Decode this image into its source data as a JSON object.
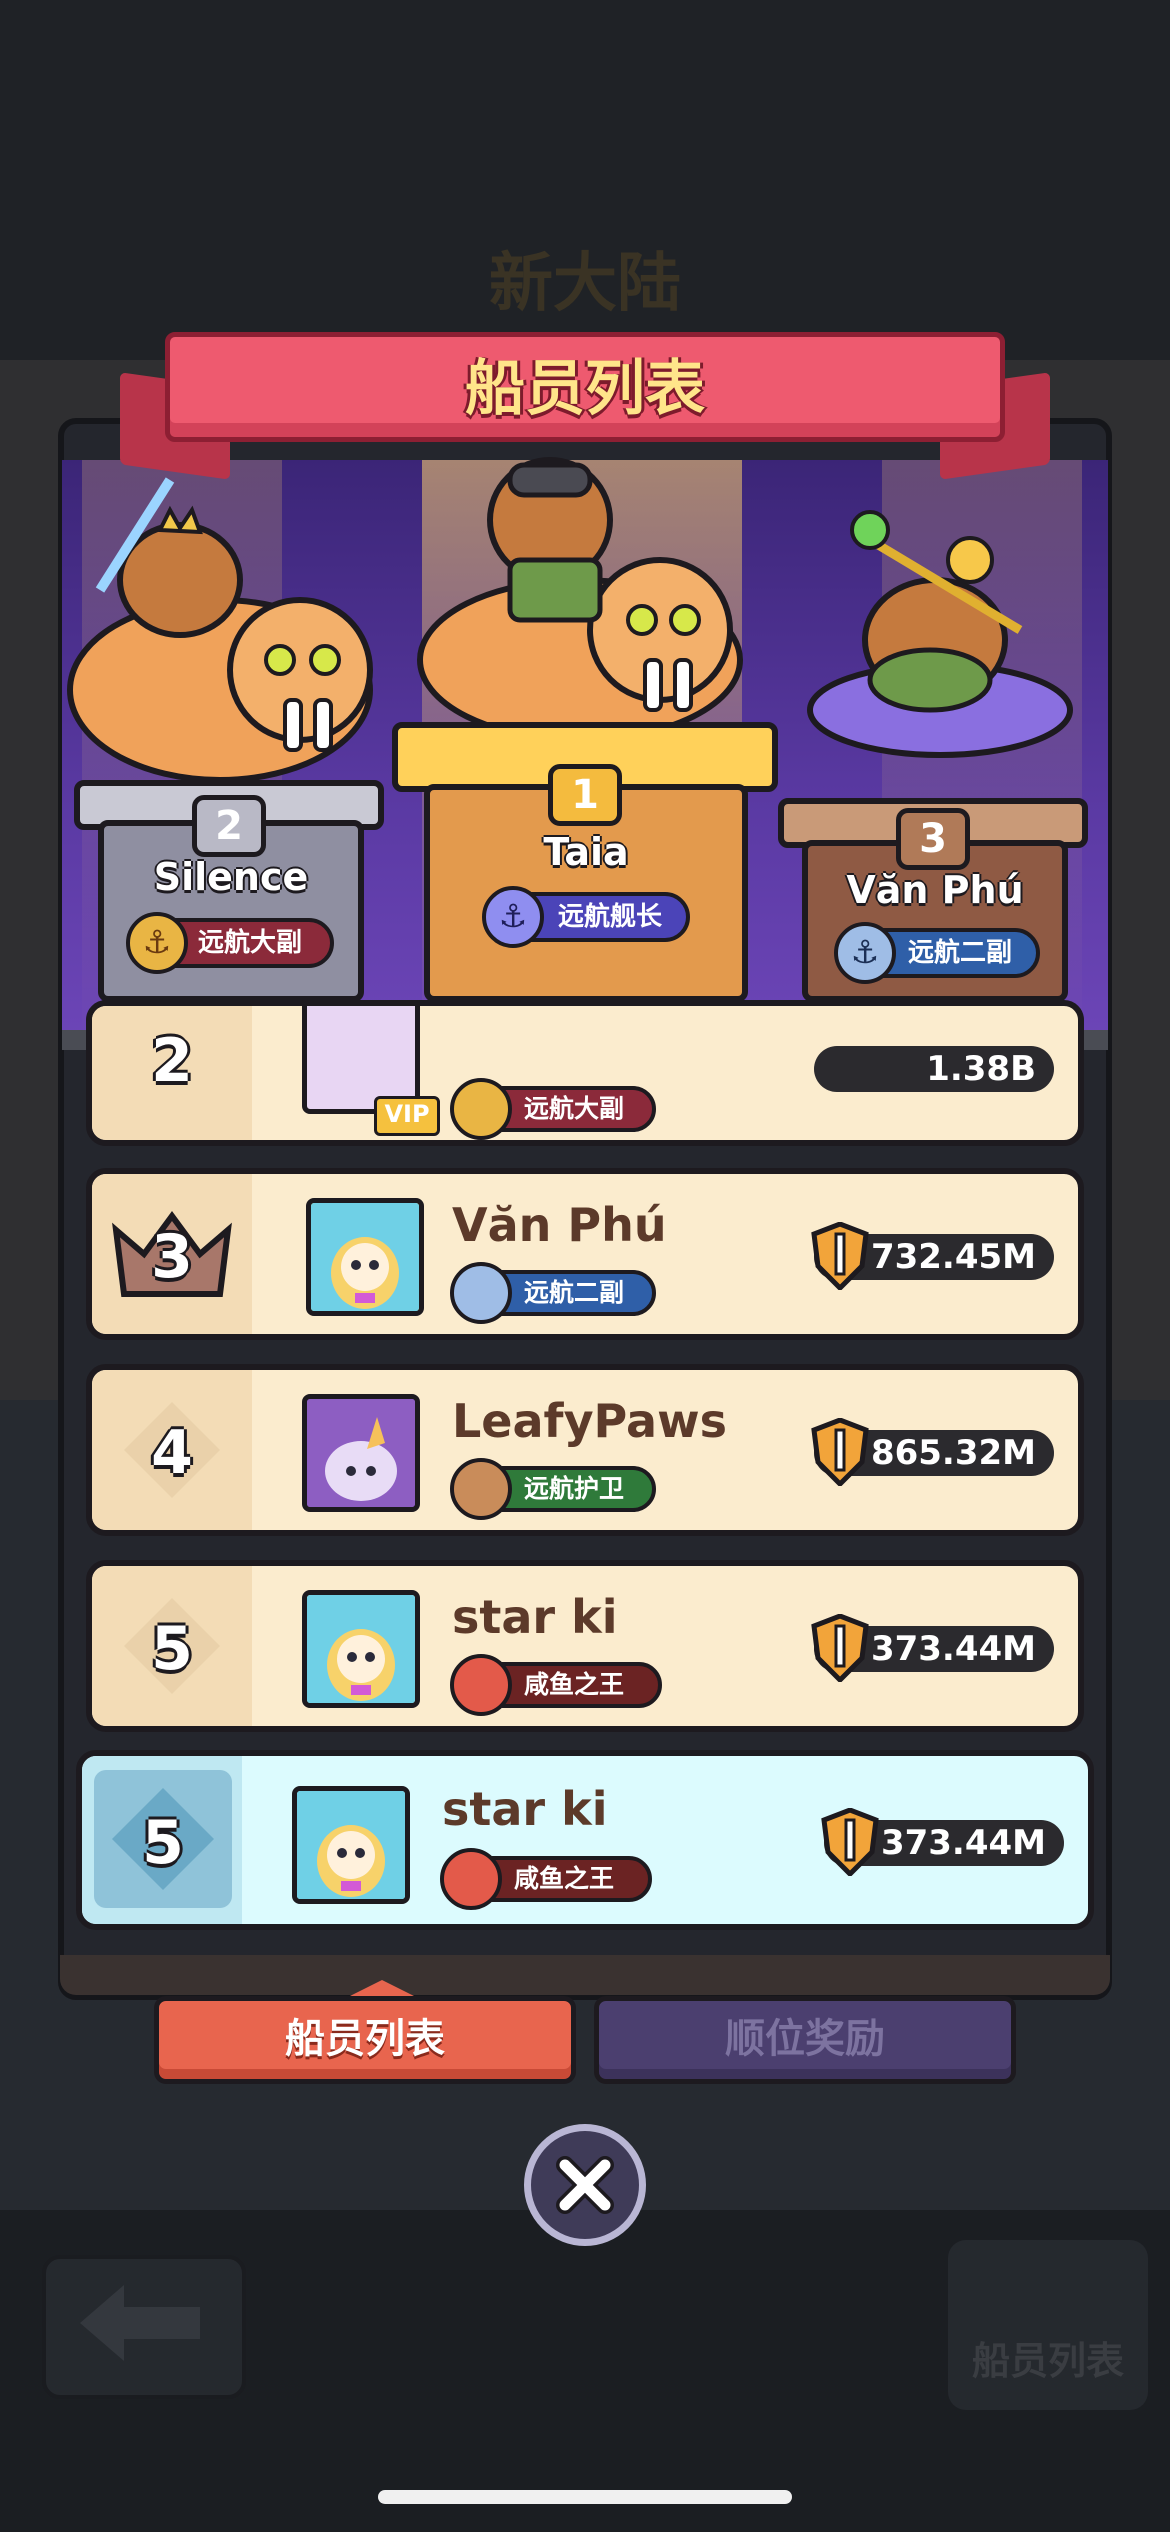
{
  "background": {
    "scene_title": "新大陆",
    "crew_button_label": "船员列表"
  },
  "header": {
    "title": "船员列表"
  },
  "podium": [
    {
      "rank": "2",
      "name": "Silence",
      "title": "远航大副",
      "color": "#c9a24a"
    },
    {
      "rank": "1",
      "name": "Taia",
      "title": "远航舰长",
      "color": "#5b5bd6"
    },
    {
      "rank": "3",
      "name": "Văn Phú",
      "title": "远航二副",
      "color": "#2f5fa8"
    }
  ],
  "list": {
    "partial_row": {
      "rank": "2",
      "title": "远航大副",
      "power": "1.38B"
    },
    "rows": [
      {
        "rank": "3",
        "name": "Văn Phú",
        "title": "远航二副",
        "power": "732.45M"
      },
      {
        "rank": "4",
        "name": "LeafyPaws",
        "title": "远航护卫",
        "power": "865.32M"
      },
      {
        "rank": "5",
        "name": "star ki",
        "title": "咸鱼之王",
        "power": "373.44M"
      }
    ],
    "me": {
      "rank": "5",
      "name": "star ki",
      "title": "咸鱼之王",
      "power": "373.44M"
    },
    "vip_badge": "VIP"
  },
  "tabs": {
    "crew_list": "船员列表",
    "rank_rewards": "顺位奖励"
  },
  "icons": {
    "close": "close-icon",
    "back": "back-arrow-icon",
    "power": "sword-shield-icon",
    "emblem": "anchor-emblem-icon"
  }
}
